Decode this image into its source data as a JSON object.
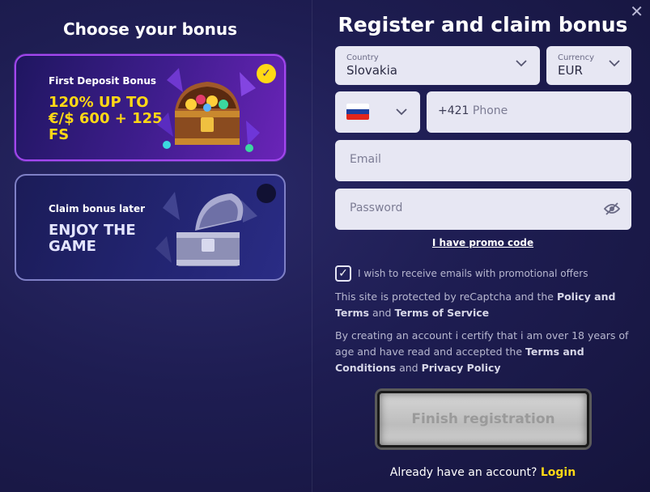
{
  "close": "✕",
  "left": {
    "title": "Choose your bonus",
    "cards": [
      {
        "label": "First Deposit Bonus",
        "big": "120% UP TO €/$ 600 + 125 FS",
        "selected": true
      },
      {
        "label": "Claim bonus later",
        "big": "ENJOY THE GAME",
        "selected": false
      }
    ]
  },
  "right": {
    "title": "Register and claim bonus",
    "country": {
      "label": "Country",
      "value": "Slovakia"
    },
    "currency": {
      "label": "Currency",
      "value": "EUR"
    },
    "phone": {
      "code": "+421",
      "placeholder": "Phone"
    },
    "email": {
      "placeholder": "Email"
    },
    "password": {
      "placeholder": "Password"
    },
    "promo": "I have promo code",
    "checkbox_label": "I wish to receive emails with promotional offers",
    "recaptcha": {
      "text1": "This site is protected by reCaptcha and the ",
      "link1": "Policy and Terms",
      "text2": " and ",
      "link2": "Terms of Service"
    },
    "terms": {
      "text1": "By creating an account i certify that i am over 18 years of age and have read and accepted the ",
      "link1": "Terms and Conditions",
      "text2": " and ",
      "link2": "Privacy Policy"
    },
    "finish": "Finish registration",
    "login_prompt": "Already have an account? ",
    "login_link": "Login"
  },
  "colors": {
    "accent": "#ffd815",
    "selected_border": "#a447f0"
  }
}
